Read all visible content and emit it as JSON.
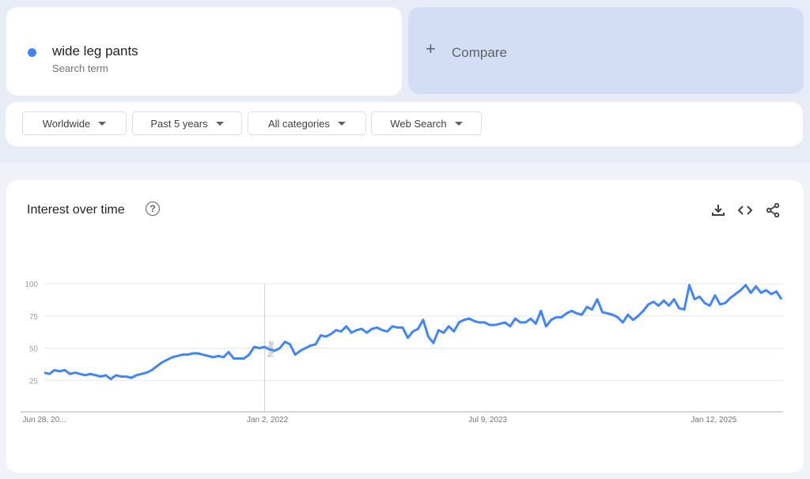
{
  "search_term": {
    "name": "wide leg pants",
    "type_label": "Search term",
    "color": "#4285f4"
  },
  "compare": {
    "icon": "plus-icon",
    "label": "Compare"
  },
  "filters": [
    {
      "label": "Worldwide"
    },
    {
      "label": "Past 5 years"
    },
    {
      "label": "All categories"
    },
    {
      "label": "Web Search"
    }
  ],
  "chart_card": {
    "title": "Interest over time",
    "help_icon": "question-circle-icon",
    "actions": [
      "download-icon",
      "embed-code-icon",
      "share-icon"
    ]
  },
  "chart_data": {
    "type": "line",
    "title": "Interest over time",
    "xlabel": "",
    "ylabel": "",
    "ylim": [
      0,
      100
    ],
    "yticks": [
      25,
      50,
      75,
      100
    ],
    "x_range_weeks": [
      0,
      261
    ],
    "xticks": [
      {
        "week": 0,
        "label": "Jun 28, 20..."
      },
      {
        "week": 79,
        "label": "Jan 2, 2022"
      },
      {
        "week": 157,
        "label": "Jul 9, 2023"
      },
      {
        "week": 237,
        "label": "Jan 12, 2025"
      }
    ],
    "annotation": {
      "week": 78,
      "label": "Note"
    },
    "grid": true,
    "series": [
      {
        "name": "wide leg pants",
        "color": "#4285f4",
        "values": [
          31,
          30,
          33,
          32,
          33,
          30,
          31,
          30,
          29,
          30,
          29,
          28,
          29,
          26,
          29,
          28,
          28,
          27,
          29,
          30,
          31,
          33,
          36,
          39,
          41,
          43,
          44,
          45,
          45,
          46,
          46,
          45,
          44,
          43,
          44,
          43,
          47,
          42,
          42,
          42,
          45,
          51,
          50,
          51,
          49,
          48,
          50,
          55,
          53,
          45,
          48,
          50,
          52,
          53,
          60,
          59,
          61,
          64,
          63,
          67,
          62,
          64,
          65,
          62,
          65,
          66,
          64,
          63,
          67,
          66,
          66,
          58,
          63,
          65,
          72,
          59,
          54,
          64,
          62,
          67,
          63,
          70,
          72,
          73,
          71,
          70,
          70,
          68,
          68,
          69,
          70,
          67,
          73,
          70,
          70,
          73,
          69,
          79,
          67,
          72,
          74,
          74,
          77,
          79,
          77,
          76,
          82,
          80,
          88,
          78,
          77,
          76,
          74,
          70,
          76,
          72,
          75,
          79,
          84,
          86,
          83,
          87,
          83,
          88,
          81,
          80,
          99,
          88,
          90,
          85,
          83,
          91,
          84,
          85,
          89,
          92,
          95,
          99,
          93,
          98,
          93,
          95,
          92,
          94,
          88
        ]
      }
    ]
  }
}
